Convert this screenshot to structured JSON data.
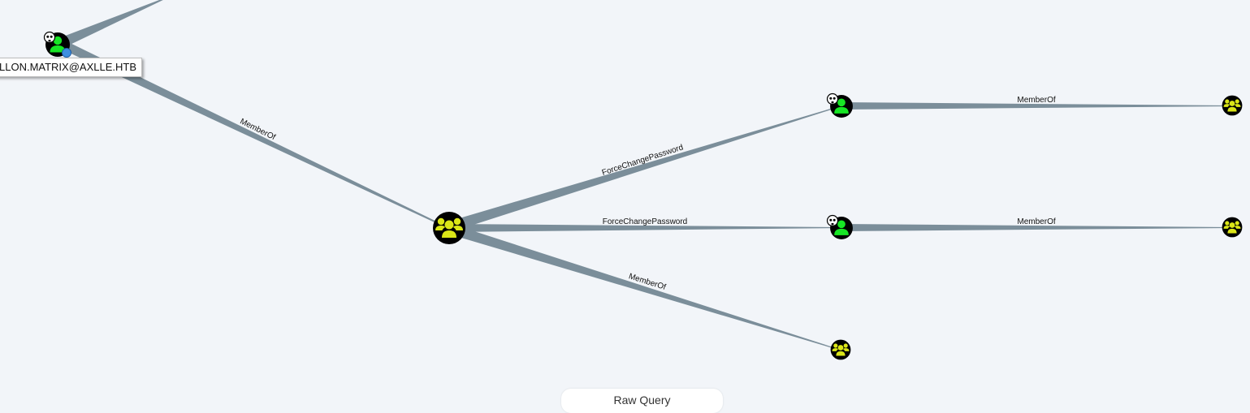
{
  "graph": {
    "user_node_label": "LLON.MATRIX@AXLLE.HTB",
    "edges": {
      "user_to_hub": "MemberOf",
      "hub_to_user_a": "ForceChangePassword",
      "hub_to_user_b": "ForceChangePassword",
      "hub_to_group_low": "MemberOf",
      "user_a_to_group": "MemberOf",
      "user_b_to_group": "MemberOf"
    },
    "colors": {
      "edge": "#7b8e9a",
      "user_node_fill": "#17e625",
      "group_node_fill": "#dbe617",
      "node_outline": "#000000",
      "background": "#f2f5f9"
    },
    "icons": {
      "user": "user-icon",
      "group": "group-icon",
      "owned_marker": "skull-icon"
    }
  },
  "toolbar": {
    "raw_query_label": "Raw Query"
  }
}
